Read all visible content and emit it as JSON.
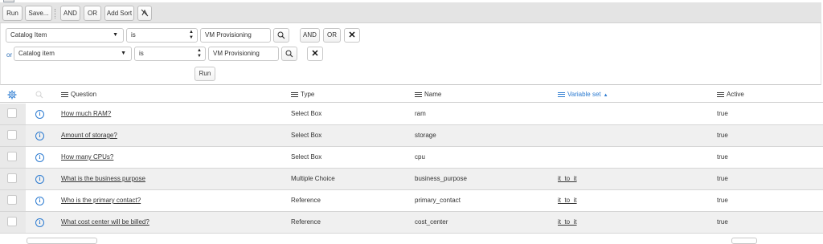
{
  "toolbar": {
    "run": "Run",
    "save": "Save...",
    "and": "AND",
    "or": "OR",
    "add_sort": "Add Sort"
  },
  "filters": {
    "row1": {
      "field": "Catalog Item",
      "operator": "is",
      "value": "VM Provisioning",
      "and": "AND",
      "or": "OR"
    },
    "row2": {
      "prefix": "or",
      "field": "Catalog item",
      "operator": "is",
      "value": "VM Provisioning"
    },
    "run": "Run"
  },
  "table": {
    "columns": {
      "question": "Question",
      "type": "Type",
      "name": "Name",
      "variable_set": "Variable set",
      "active": "Active"
    },
    "sorted_column": "variable_set",
    "sort_direction": "ascending",
    "rows": [
      {
        "question": "How much RAM?",
        "type": "Select Box",
        "name": "ram",
        "variable_set": "",
        "active": "true"
      },
      {
        "question": "Amount of storage?",
        "type": "Select Box",
        "name": "storage",
        "variable_set": "",
        "active": "true"
      },
      {
        "question": "How many CPUs?",
        "type": "Select Box",
        "name": "cpu",
        "variable_set": "",
        "active": "true"
      },
      {
        "question": "What is the business purpose",
        "type": "Multiple Choice",
        "name": "business_purpose",
        "variable_set": "it_to_it",
        "active": "true"
      },
      {
        "question": "Who is the primary contact?",
        "type": "Reference",
        "name": "primary_contact",
        "variable_set": "it_to_it",
        "active": "true"
      },
      {
        "question": "What cost center will be billed?",
        "type": "Reference",
        "name": "cost_center",
        "variable_set": "it_to_it",
        "active": "true"
      }
    ]
  },
  "colors": {
    "accent": "#2c7bd1",
    "toolbar_bg": "#e4e4e4",
    "row_alt": "#f0f0f0"
  },
  "icons": {
    "clear_sort": "clear-sort-icon",
    "search": "magnifier-icon",
    "remove": "close-icon",
    "settings": "gear-icon",
    "column_menu": "hamburger-icon",
    "info": "info-icon"
  }
}
